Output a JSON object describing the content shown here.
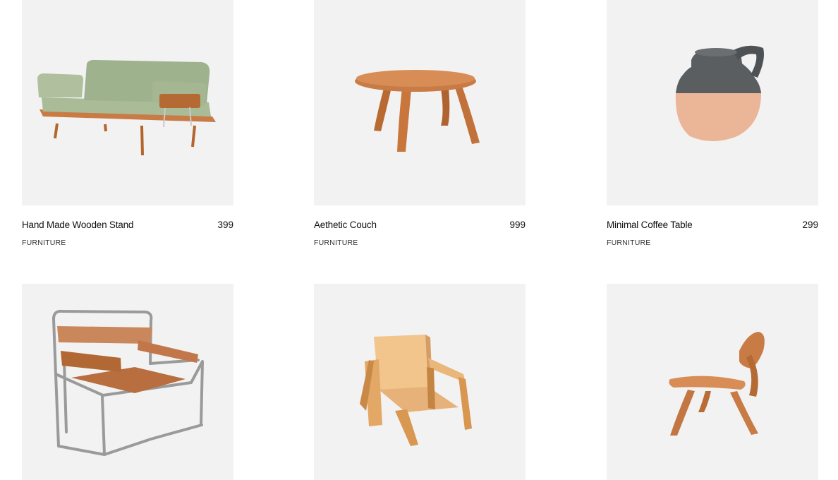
{
  "products": [
    {
      "title": "Hand Made Wooden Stand",
      "price": "399",
      "category": "FURNITURE",
      "icon": "green-daybed-sofa"
    },
    {
      "title": "Aethetic Couch",
      "price": "999",
      "category": "FURNITURE",
      "icon": "round-wooden-coffee-table"
    },
    {
      "title": "Minimal Coffee Table",
      "price": "299",
      "category": "FURNITURE",
      "icon": "ceramic-pitcher-vase"
    },
    {
      "title": "",
      "price": "",
      "category": "",
      "icon": "chrome-leather-sling-chair"
    },
    {
      "title": "",
      "price": "",
      "category": "",
      "icon": "pine-wood-armchair"
    },
    {
      "title": "",
      "price": "",
      "category": "",
      "icon": "bent-plywood-lounge-chair"
    }
  ],
  "colors": {
    "card_bg": "#f2f2f2",
    "text": "#111111",
    "sofa_fabric": "#a9bb97",
    "wood": "#c97b45",
    "ceramic_dark": "#5b5e61",
    "ceramic_light": "#ebb597"
  }
}
